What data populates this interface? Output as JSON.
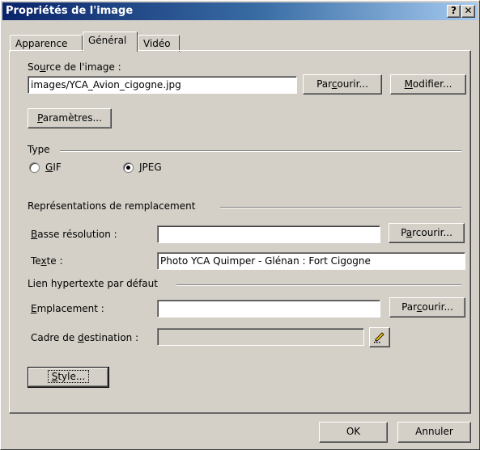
{
  "window": {
    "title": "Propriétés de l'image",
    "help_button": "?",
    "close_button": "✕"
  },
  "tabs": [
    {
      "label": "Apparence",
      "active": false
    },
    {
      "label": "Général",
      "active": true
    },
    {
      "label": "Vidéo",
      "active": false
    }
  ],
  "source": {
    "label_pre": "So",
    "label_u": "u",
    "label_post": "rce de l'image :",
    "value": "images/YCA_Avion_cigogne.jpg",
    "browse_pre": "Par",
    "browse_u": "c",
    "browse_post": "ourir...",
    "edit_u": "M",
    "edit_post": "odifier..."
  },
  "parameters": {
    "u": "P",
    "post": "aramètres..."
  },
  "type": {
    "label": "Type",
    "options": [
      {
        "u": "G",
        "post": "IF",
        "selected": false
      },
      {
        "u": "J",
        "post": "PEG",
        "selected": true
      }
    ]
  },
  "alternates": {
    "heading": "Représentations de remplacement",
    "low_res_u": "B",
    "low_res_post": "asse résolution :",
    "low_res_value": "",
    "low_res_browse_pre": "P",
    "low_res_browse_u": "a",
    "low_res_browse_post": "rcourir...",
    "text_pre": "Te",
    "text_u": "x",
    "text_post": "te :",
    "text_value": "Photo YCA Quimper - Glénan : Fort Cigogne"
  },
  "hyperlink": {
    "heading": "Lien hypertexte par défaut",
    "location_u": "E",
    "location_post": "mplacement :",
    "location_value": "",
    "browse_pre": "Par",
    "browse_u": "c",
    "browse_post": "ourir...",
    "target_pre": "Cadre de ",
    "target_u": "d",
    "target_post": "estination :",
    "target_value": "",
    "target_button_icon": "pencil-icon"
  },
  "style_button": {
    "u": "S",
    "post": "tyle..."
  },
  "footer": {
    "ok": "OK",
    "cancel": "Annuler"
  }
}
